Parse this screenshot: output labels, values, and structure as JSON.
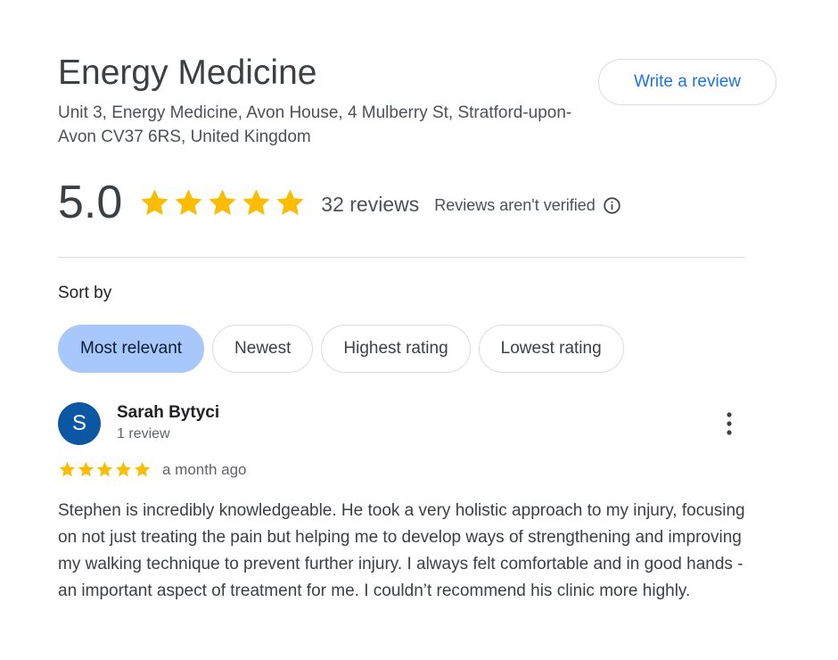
{
  "place": {
    "name": "Energy Medicine",
    "address": "Unit 3, Energy Medicine, Avon House, 4 Mulberry St, Stratford-upon-Avon CV37 6RS, United Kingdom"
  },
  "actions": {
    "write_review_label": "Write a review"
  },
  "summary": {
    "score": "5.0",
    "stars": 5,
    "review_count_label": "32 reviews",
    "verification_note": "Reviews aren't verified",
    "star_color": "#fbbc04",
    "info_icon": "info-icon"
  },
  "sort": {
    "label": "Sort by",
    "options": [
      "Most relevant",
      "Newest",
      "Highest rating",
      "Lowest rating"
    ],
    "selected": "Most relevant",
    "selected_color": "#a8c7fa"
  },
  "reviews": [
    {
      "avatar_letter": "S",
      "avatar_color": "#0b57a4",
      "author": "Sarah Bytyci",
      "author_meta": "1 review",
      "stars": 5,
      "date": "a month ago",
      "text": "Stephen is incredibly knowledgeable. He took a very holistic approach to my injury, focusing on not just treating the pain but helping me to develop ways of strengthening and improving my walking technique to prevent further injury. I always felt comfortable and in good hands - an important aspect of treatment for me. I couldn’t recommend his clinic more highly.",
      "menu_icon": "more-vert-icon"
    }
  ]
}
